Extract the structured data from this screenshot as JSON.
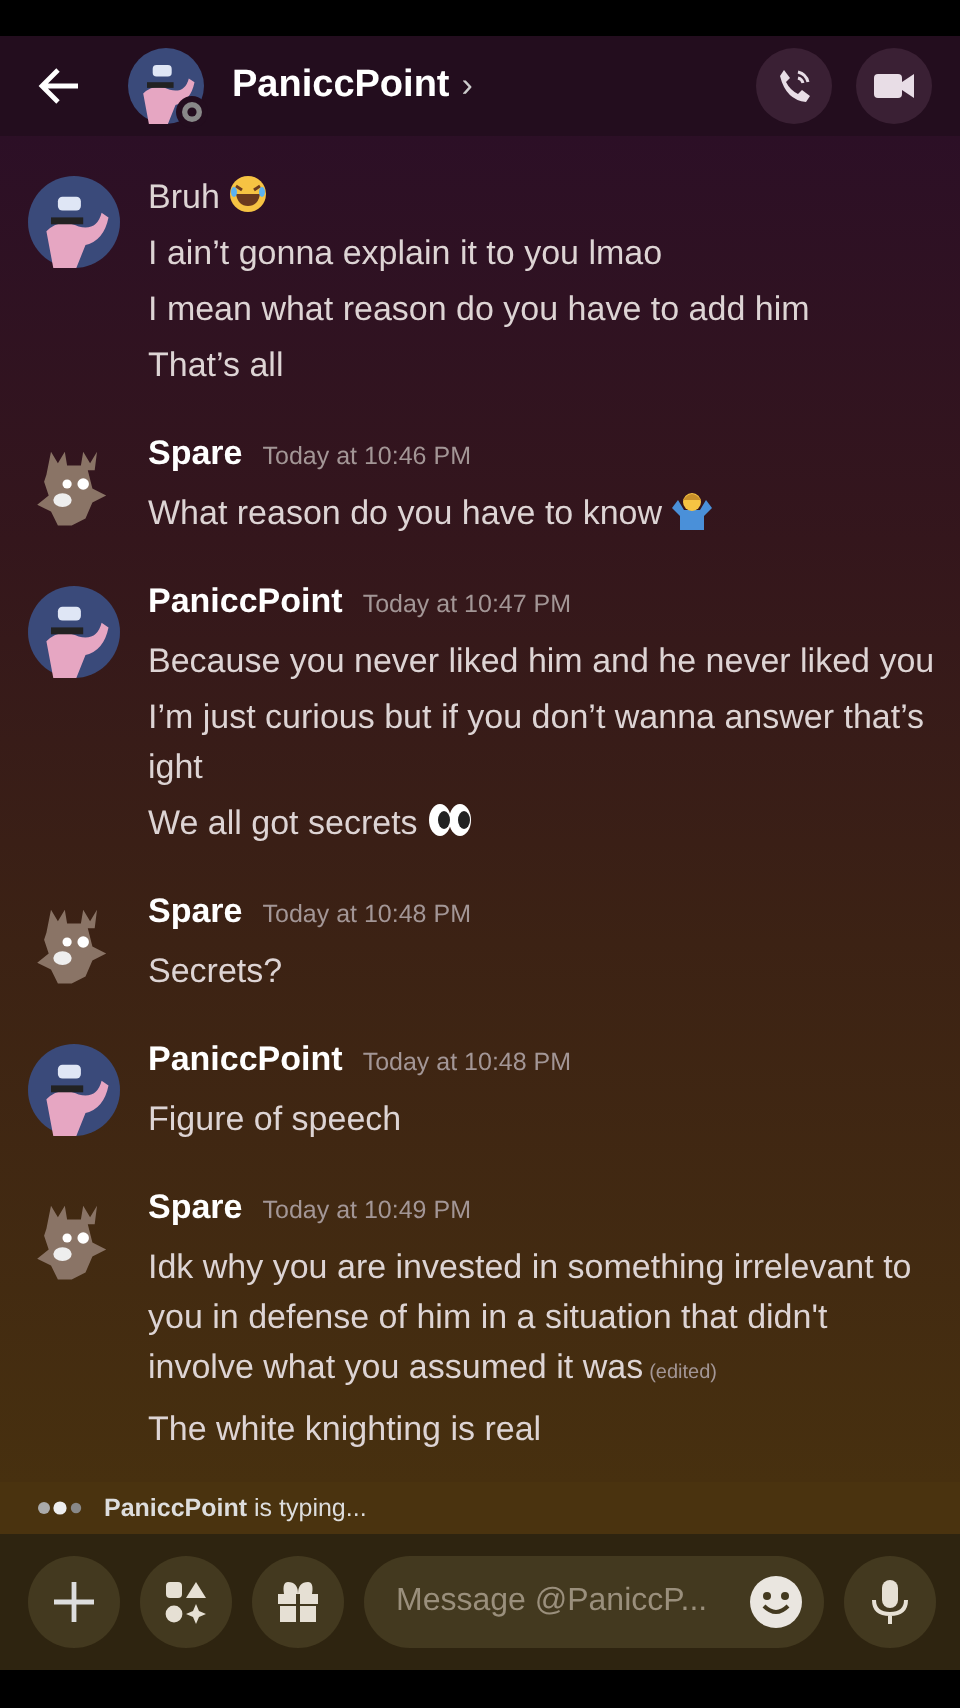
{
  "header": {
    "title": "PaniccPoint",
    "chevron": "›"
  },
  "messages": [
    {
      "kind": "panther",
      "lines": [
        {
          "kind": "laughing",
          "text": "Bruh"
        },
        {
          "kind": "plain",
          "text": "I ain’t gonna explain it to you lmao"
        },
        {
          "kind": "plain",
          "text": "I mean what reason do you have to add him"
        },
        {
          "kind": "plain",
          "text": "That’s all"
        }
      ]
    },
    {
      "kind": "deer",
      "author": "Spare",
      "timestamp": "Today at 10:46 PM",
      "lines": [
        {
          "kind": "shrug",
          "text": "What reason do you have to know"
        }
      ]
    },
    {
      "kind": "panther",
      "author": "PaniccPoint",
      "timestamp": "Today at 10:47 PM",
      "lines": [
        {
          "kind": "plain",
          "text": "Because you never liked him and he never liked you"
        },
        {
          "kind": "plain",
          "text": "I’m just curious but if you don’t wanna answer that’s ight"
        },
        {
          "kind": "eyes",
          "text": "We all got secrets"
        }
      ]
    },
    {
      "kind": "deer",
      "author": "Spare",
      "timestamp": "Today at 10:48 PM",
      "lines": [
        {
          "kind": "plain",
          "text": "Secrets?"
        }
      ]
    },
    {
      "kind": "panther",
      "author": "PaniccPoint",
      "timestamp": "Today at 10:48 PM",
      "lines": [
        {
          "kind": "plain",
          "text": "Figure of speech"
        }
      ]
    },
    {
      "kind": "deer",
      "author": "Spare",
      "timestamp": "Today at 10:49 PM",
      "lines": [
        {
          "kind": "plain",
          "text": "Idk why you are invested in something irrelevant to you in defense of him in a situation that didn't involve what you assumed it was",
          "edited": "(edited)"
        },
        {
          "kind": "plain",
          "text": "The white knighting is real"
        }
      ]
    }
  ],
  "typing": {
    "text": "**PaniccPoint** is typing..."
  },
  "composer": {
    "placeholder": "Message @PaniccP..."
  }
}
